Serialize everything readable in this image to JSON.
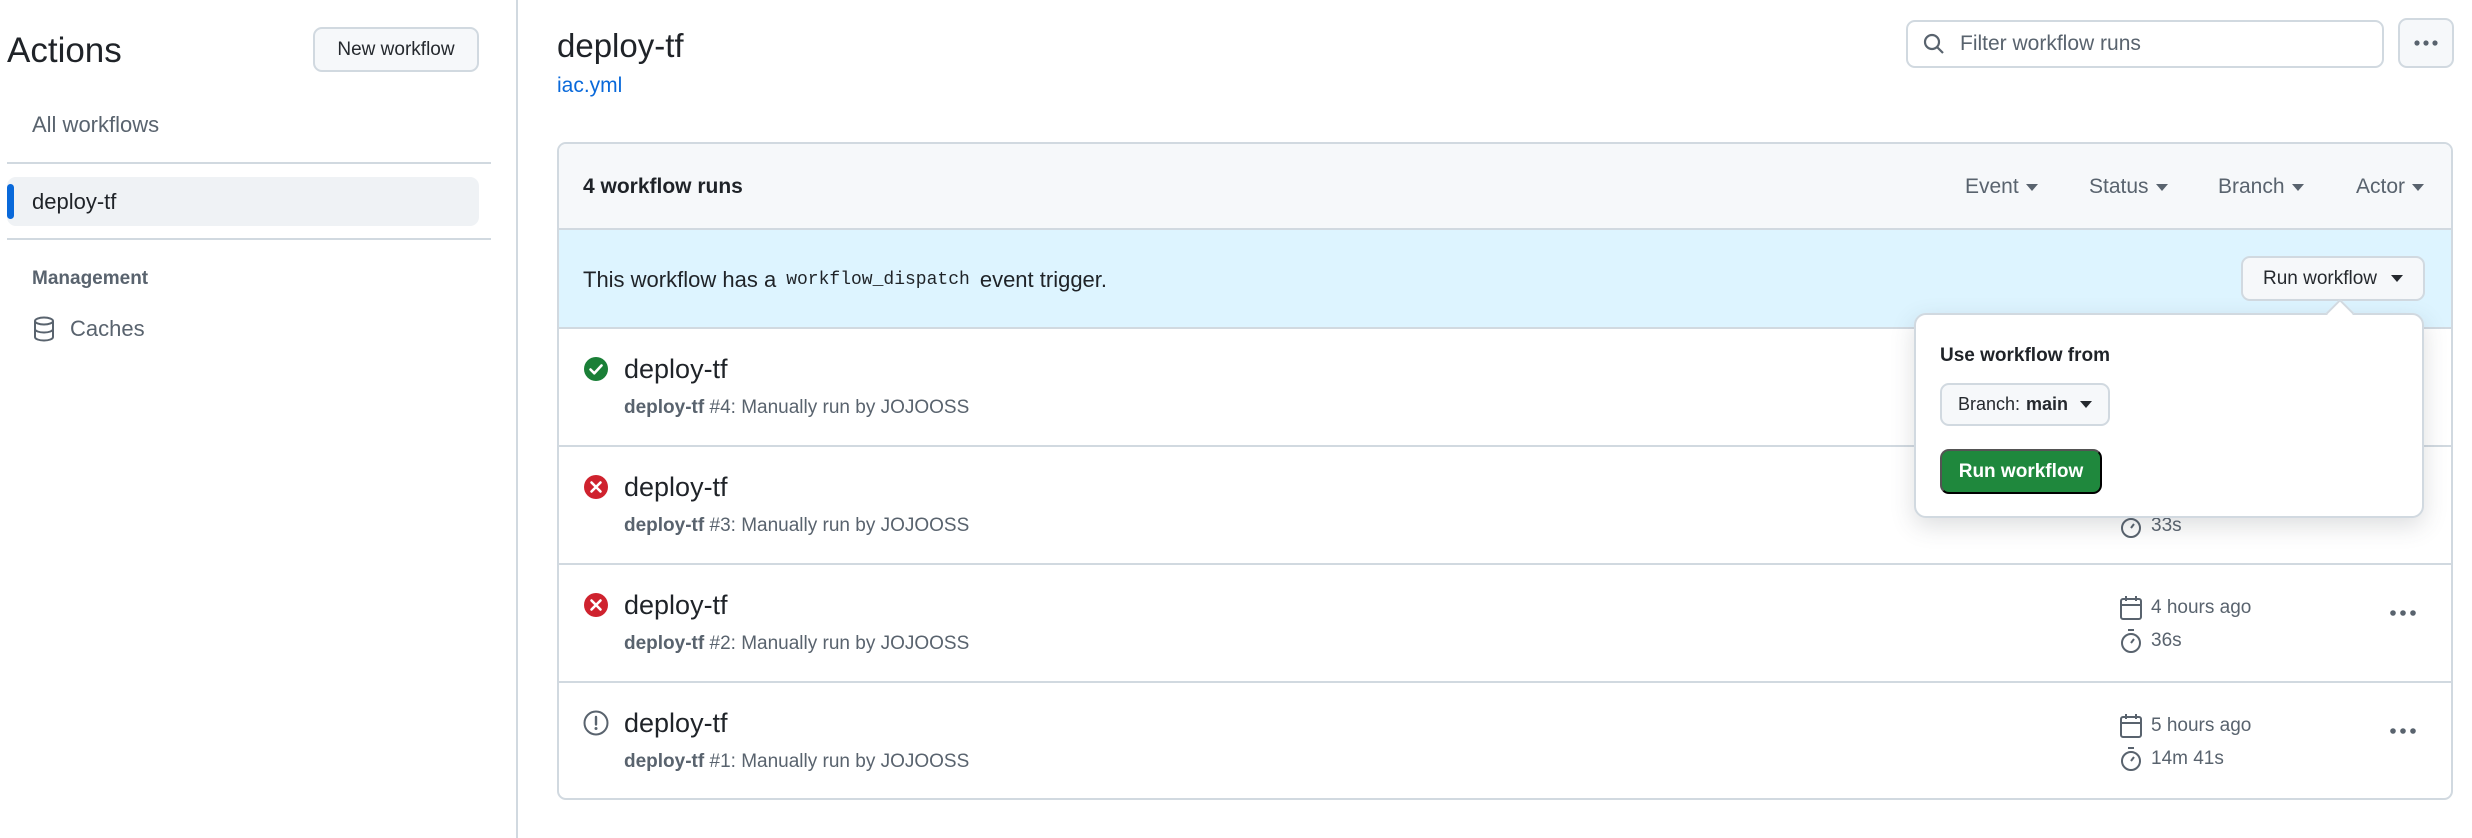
{
  "sidebar": {
    "title": "Actions",
    "new_workflow_label": "New workflow",
    "all_workflows_label": "All workflows",
    "active_workflow_label": "deploy-tf",
    "management_label": "Management",
    "caches_label": "Caches"
  },
  "header": {
    "title": "deploy-tf",
    "file_link": "iac.yml",
    "search_placeholder": "Filter workflow runs"
  },
  "runs": {
    "count_label": "4 workflow runs",
    "filters": [
      "Event",
      "Status",
      "Branch",
      "Actor"
    ],
    "dispatch_text_before": "This workflow has a",
    "dispatch_code": "workflow_dispatch",
    "dispatch_text_after": "event trigger.",
    "run_workflow_label": "Run workflow",
    "items": [
      {
        "status": "success",
        "title": "deploy-tf",
        "sub_name": "deploy-tf",
        "sub_rest": "#4: Manually run by JOJOOSS"
      },
      {
        "status": "failure",
        "title": "deploy-tf",
        "sub_name": "deploy-tf",
        "sub_rest": "#3: Manually run by JOJOOSS",
        "duration": "33s"
      },
      {
        "status": "failure",
        "title": "deploy-tf",
        "sub_name": "deploy-tf",
        "sub_rest": "#2: Manually run by JOJOOSS",
        "time_ago": "4 hours ago",
        "duration": "36s"
      },
      {
        "status": "startup-failure",
        "title": "deploy-tf",
        "sub_name": "deploy-tf",
        "sub_rest": "#1: Manually run by JOJOOSS",
        "time_ago": "5 hours ago",
        "duration": "14m 41s"
      }
    ]
  },
  "popover": {
    "use_from_label": "Use workflow from",
    "branch_prefix": "Branch:",
    "branch_value": "main",
    "run_button_label": "Run workflow"
  },
  "colors": {
    "accent": "#0969da",
    "success": "#1a7f37",
    "failure": "#cf222e",
    "primary_button": "#1f883d",
    "banner": "#ddf4ff"
  }
}
